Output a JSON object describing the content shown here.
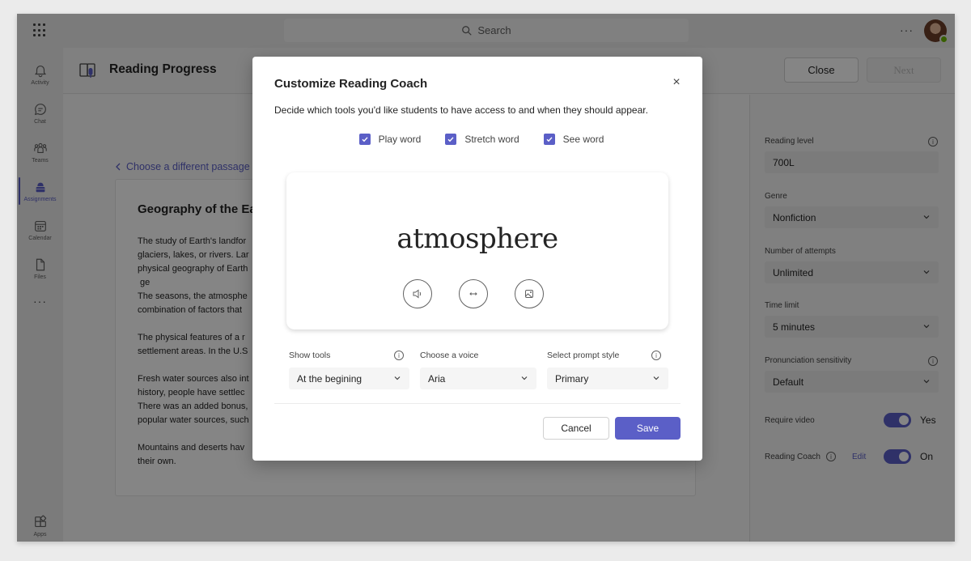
{
  "titlebar": {
    "search_placeholder": "Search",
    "more_label": "···"
  },
  "rail": {
    "items": [
      {
        "label": "Activity",
        "icon": "bell-icon"
      },
      {
        "label": "Chat",
        "icon": "chat-icon"
      },
      {
        "label": "Teams",
        "icon": "teams-icon"
      },
      {
        "label": "Assignments",
        "icon": "assignments-icon",
        "active": true
      },
      {
        "label": "Calendar",
        "icon": "calendar-icon"
      },
      {
        "label": "Files",
        "icon": "file-icon"
      }
    ],
    "more_label": "···",
    "apps_label": "Apps"
  },
  "header": {
    "title": "Reading Progress",
    "close_label": "Close",
    "next_label": "Next"
  },
  "content": {
    "back_link": "Choose a different passage",
    "passage": {
      "title": "Geography of the Ea",
      "paragraphs": [
        [
          "The study of Earth's landfor",
          "glaciers, lakes, or rivers. Lar",
          "physical geography of Earth",
          " ge",
          "The seasons, the atmosphe",
          "combination of factors that"
        ],
        [
          "The physical features of a r",
          "settlement areas. In the U.S"
        ],
        [
          "Fresh water sources also int",
          "history, people have settlec",
          "There was an added bonus,",
          "popular water sources, such"
        ],
        [
          "Mountains and deserts hav",
          "their own."
        ]
      ]
    }
  },
  "settings": {
    "reading_level": {
      "label": "Reading level",
      "value": "700L"
    },
    "genre": {
      "label": "Genre",
      "value": "Nonfiction"
    },
    "attempts": {
      "label": "Number of attempts",
      "value": "Unlimited"
    },
    "time_limit": {
      "label": "Time limit",
      "value": "5 minutes"
    },
    "pronunciation": {
      "label": "Pronunciation sensitivity",
      "value": "Default"
    },
    "require_video": {
      "label": "Require video",
      "state": "Yes",
      "on": true
    },
    "reading_coach": {
      "label": "Reading Coach",
      "edit_label": "Edit",
      "state": "On",
      "on": true
    }
  },
  "modal": {
    "title": "Customize Reading Coach",
    "close_icon": "×",
    "description": "Decide which tools you'd like students to have access to and when they should appear.",
    "checkboxes": [
      {
        "label": "Play word",
        "checked": true
      },
      {
        "label": "Stretch word",
        "checked": true
      },
      {
        "label": "See word",
        "checked": true
      }
    ],
    "preview_word": "atmosphere",
    "tool_icons": [
      "speaker-icon",
      "stretch-arrows-icon",
      "image-icon"
    ],
    "selects": {
      "show_tools": {
        "label": "Show tools",
        "value": "At the begining"
      },
      "voice": {
        "label": "Choose a voice",
        "value": "Aria"
      },
      "prompt_style": {
        "label": "Select prompt style",
        "value": "Primary"
      }
    },
    "cancel_label": "Cancel",
    "save_label": "Save"
  },
  "colors": {
    "accent": "#5b5fc7",
    "overlay": "rgba(0,0,0,0.48)"
  }
}
